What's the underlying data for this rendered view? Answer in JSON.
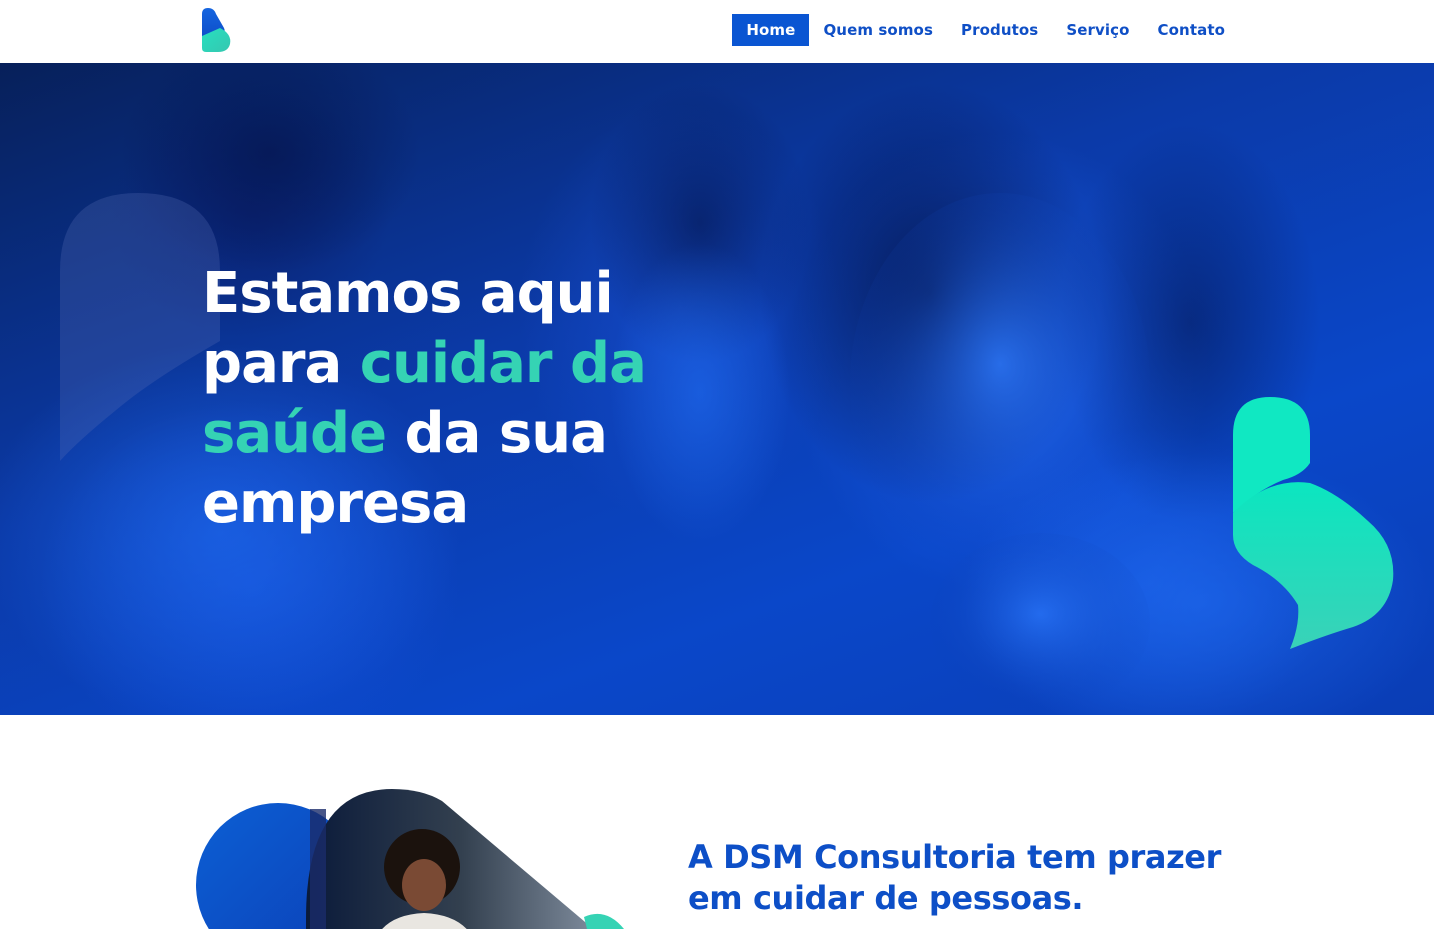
{
  "header": {
    "logo_icon": "brand-b-logo-icon",
    "nav": {
      "home": "Home",
      "about": "Quem somos",
      "products": "Produtos",
      "service": "Serviço",
      "contact": "Contato"
    }
  },
  "hero": {
    "line1": "Estamos aqui",
    "line2_plain": "para ",
    "line2_accent": "cuidar da",
    "line3_accent": "saúde",
    "line3_plain": " da sua",
    "line4": "empresa"
  },
  "about": {
    "heading_line1": "A DSM Consultoria tem prazer",
    "heading_line2": "em cuidar de pessoas."
  },
  "colors": {
    "brand_blue": "#0a55d2",
    "accent_green": "#35d3b4",
    "heading_blue": "#0d4fc7"
  }
}
